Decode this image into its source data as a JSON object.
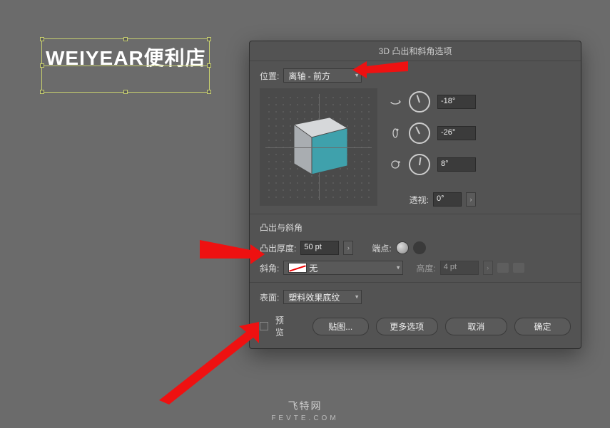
{
  "artboard": {
    "text": "WEIYEAR便利店"
  },
  "dialog": {
    "title": "3D 凸出和斜角选项",
    "position_label": "位置:",
    "position_value": "离轴 - 前方",
    "angles": {
      "x": "-18°",
      "y": "-26°",
      "z": "8°"
    },
    "perspective_label": "透视:",
    "perspective_value": "0°",
    "extrude_section": "凸出与斜角",
    "extrude_depth_label": "凸出厚度:",
    "extrude_depth_value": "50 pt",
    "cap_label": "端点:",
    "bevel_label": "斜角:",
    "bevel_value": "无",
    "bevel_height_label": "高度:",
    "bevel_height_value": "4 pt",
    "surface_label": "表面:",
    "surface_value": "塑料效果底纹",
    "preview_label": "预览",
    "btn_map": "贴图...",
    "btn_more": "更多选项",
    "btn_cancel": "取消",
    "btn_ok": "确定"
  },
  "watermark": {
    "line1": "飞特网",
    "line2": "FEVTE.COM"
  }
}
